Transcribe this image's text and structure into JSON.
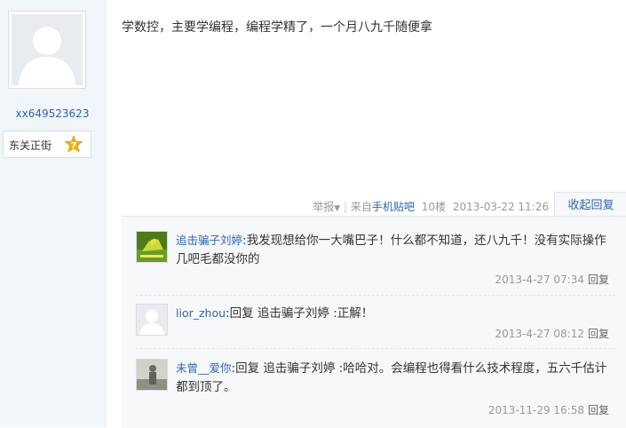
{
  "author": {
    "username": "xx649523623",
    "bar_name": "东关正街",
    "level": "7"
  },
  "post": {
    "content": "学数控，主要学编程，编程学精了，一个月八九千随便拿",
    "report": "举报",
    "from_prefix": "来自",
    "from_link": "手机贴吧",
    "floor": "10楼",
    "time": "2013-03-22 11:26",
    "collapse": "收起回复"
  },
  "replies": [
    {
      "user": "追击骗子刘婷",
      "sep": ":",
      "text": "我发现想给你一大嘴巴子！什么都不知道，还八九千！没有实际操作几吧毛都没你的",
      "time": "2013-4-27 07:34",
      "reply_label": "回复"
    },
    {
      "user": "lior_zhou",
      "sep": ":",
      "text": "回复 追击骗子刘婷 :正解！",
      "time": "2013-4-27 08:12",
      "reply_label": "回复"
    },
    {
      "user": "未曾__爱你",
      "sep": ":",
      "text": "回复 追击骗子刘婷 :哈哈对。会编程也得看什么技术程度，五六千估计都到顶了。",
      "time": "2013-11-29 16:58",
      "reply_label": "回复"
    }
  ],
  "colors": {
    "link": "#2d64b3",
    "sidebar_bg": "#f1f6fb",
    "badge": "#f0b400"
  }
}
